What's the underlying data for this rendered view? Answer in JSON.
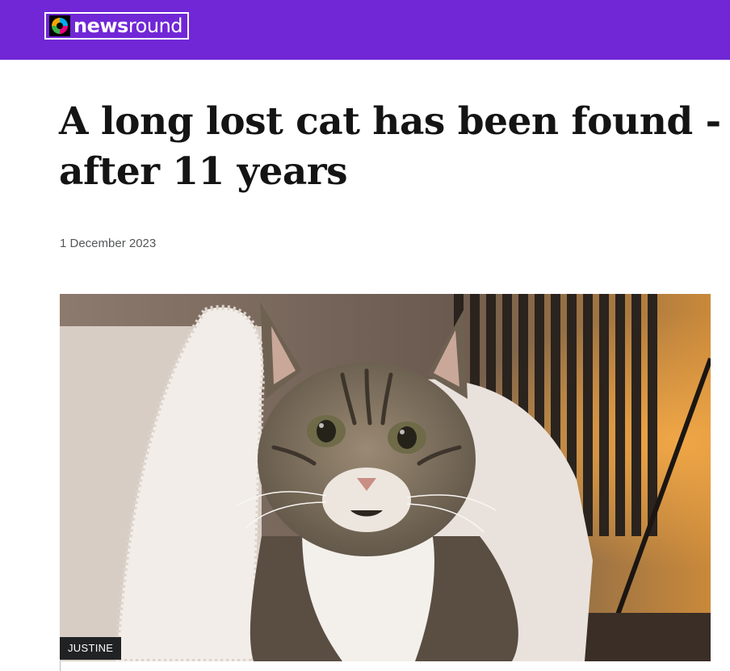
{
  "header": {
    "brand_bold": "news",
    "brand_rest": "round",
    "logo_icon": "cbbc-logo-icon",
    "background_color": "#7127d6"
  },
  "article": {
    "headline": "A long lost cat has been found - after 11 years",
    "date": "1 December 2023",
    "image": {
      "subject": "tabby cat with white chest sitting on a cream armchair",
      "credit": "JUSTINE"
    }
  }
}
